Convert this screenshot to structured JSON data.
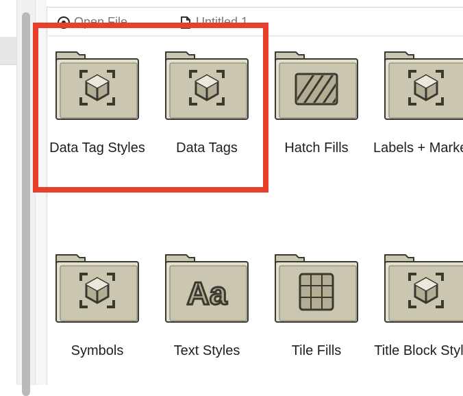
{
  "tabs": [
    {
      "label": "Open File..."
    },
    {
      "label": "Untitled 1"
    }
  ],
  "items": [
    {
      "label": "Data Tag Styles",
      "icon": "cube-icon"
    },
    {
      "label": "Data Tags",
      "icon": "cube-icon"
    },
    {
      "label": "Hatch Fills",
      "icon": "hatch-icon"
    },
    {
      "label": "Labels + Markers",
      "icon": "cube-icon"
    },
    {
      "label": "Symbols",
      "icon": "cube-icon"
    },
    {
      "label": "Text Styles",
      "icon": "text-aa-icon"
    },
    {
      "label": "Tile Fills",
      "icon": "grid-icon"
    },
    {
      "label": "Title Block Styles",
      "icon": "cube-icon"
    }
  ],
  "colors": {
    "highlight": "#e8402a",
    "folder_fill": "#cbc6b0",
    "folder_stroke": "#3a392f",
    "folder_inner": "#e3e0d0"
  },
  "texts": {
    "aa_glyph": "Aa"
  }
}
